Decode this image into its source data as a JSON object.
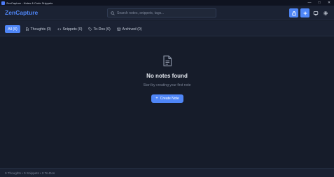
{
  "window": {
    "title": "ZenCapture - Notes & Code Snippets",
    "controls": {
      "minimize": "—",
      "maximize": "□",
      "close": "✕"
    }
  },
  "header": {
    "brand": "ZenCapture",
    "search_placeholder": "Search notes, snippets, tags...",
    "icons": [
      "lock-icon",
      "plus-icon",
      "monitor-icon",
      "gear-icon"
    ],
    "accent_color": "#4f86f7"
  },
  "tabs": [
    {
      "label": "All (0)",
      "icon": "",
      "active": true
    },
    {
      "label": "Thoughts (0)",
      "icon": "document-icon",
      "active": false
    },
    {
      "label": "Snippets (0)",
      "icon": "code-icon",
      "active": false
    },
    {
      "label": "To-Dos (0)",
      "icon": "tag-icon",
      "active": false
    },
    {
      "label": "Archived (0)",
      "icon": "archive-icon",
      "active": false
    }
  ],
  "empty_state": {
    "icon": "document-icon",
    "title": "No notes found",
    "subtitle": "Start by creating your first note",
    "button_icon": "+",
    "button_label": "Create Note"
  },
  "status": {
    "text": "0 Thoughts • 0 Snippets • 0 To-Dos"
  }
}
